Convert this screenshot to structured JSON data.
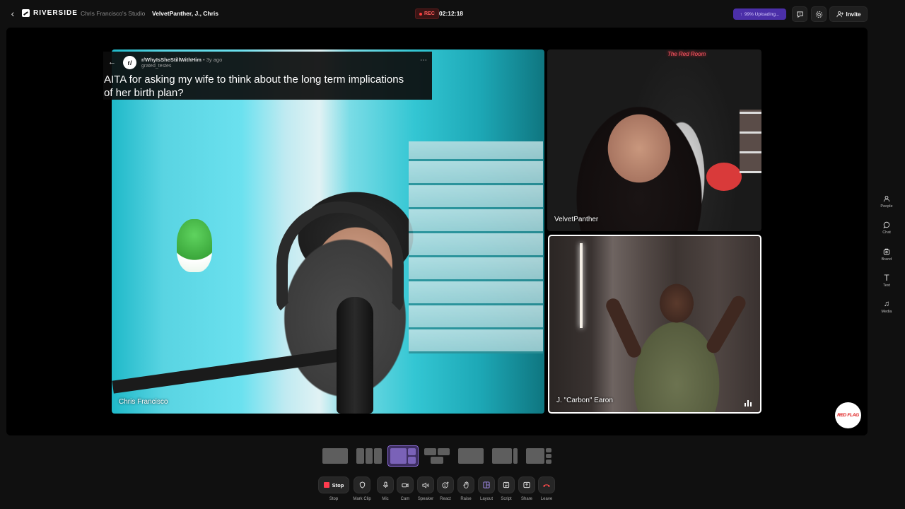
{
  "header": {
    "logo_text": "RIVERSIDE",
    "studio_name": "Chris Francisco's Studio",
    "session_title": "VelvetPanther, J., Chris",
    "rec_label": "REC",
    "timer": "02:12:18",
    "upload_status": "99% Uploading...",
    "invite_label": "Invite"
  },
  "reddit_post": {
    "avatar_text": "r/",
    "subreddit": "r/WhyIsSheStillWithHim",
    "age": "• 3y ago",
    "username": "grated_testes",
    "title": "AITA for asking my wife to think about the long term implications of her birth plan?"
  },
  "participants": [
    {
      "name": "Chris Francisco"
    },
    {
      "name": "VelvetPanther"
    },
    {
      "name": "J. \"Carbon\" Earon"
    }
  ],
  "neon_sign": "The Red Room",
  "watermark": "RED FLAG",
  "sidenav": [
    {
      "label": "People",
      "icon": "people-icon"
    },
    {
      "label": "Chat",
      "icon": "chat-icon"
    },
    {
      "label": "Brand",
      "icon": "brand-icon"
    },
    {
      "label": "Text",
      "icon": "text-icon"
    },
    {
      "label": "Media",
      "icon": "media-icon"
    }
  ],
  "layouts": [
    "single",
    "side-by-side",
    "main-plus-two",
    "grid",
    "single-pip",
    "pip-side",
    "main-plus-stack"
  ],
  "selected_layout": "main-plus-two",
  "controls": [
    {
      "label": "Stop",
      "button_text": "Stop"
    },
    {
      "label": "Mark Clip"
    },
    {
      "label": "Mic"
    },
    {
      "label": "Cam"
    },
    {
      "label": "Speaker"
    },
    {
      "label": "React"
    },
    {
      "label": "Raise"
    },
    {
      "label": "Layout"
    },
    {
      "label": "Script"
    },
    {
      "label": "Share"
    },
    {
      "label": "Leave"
    }
  ],
  "colors": {
    "accent": "#8b6bd8",
    "record": "#ff3b4e",
    "upload": "#4b2fa8"
  }
}
